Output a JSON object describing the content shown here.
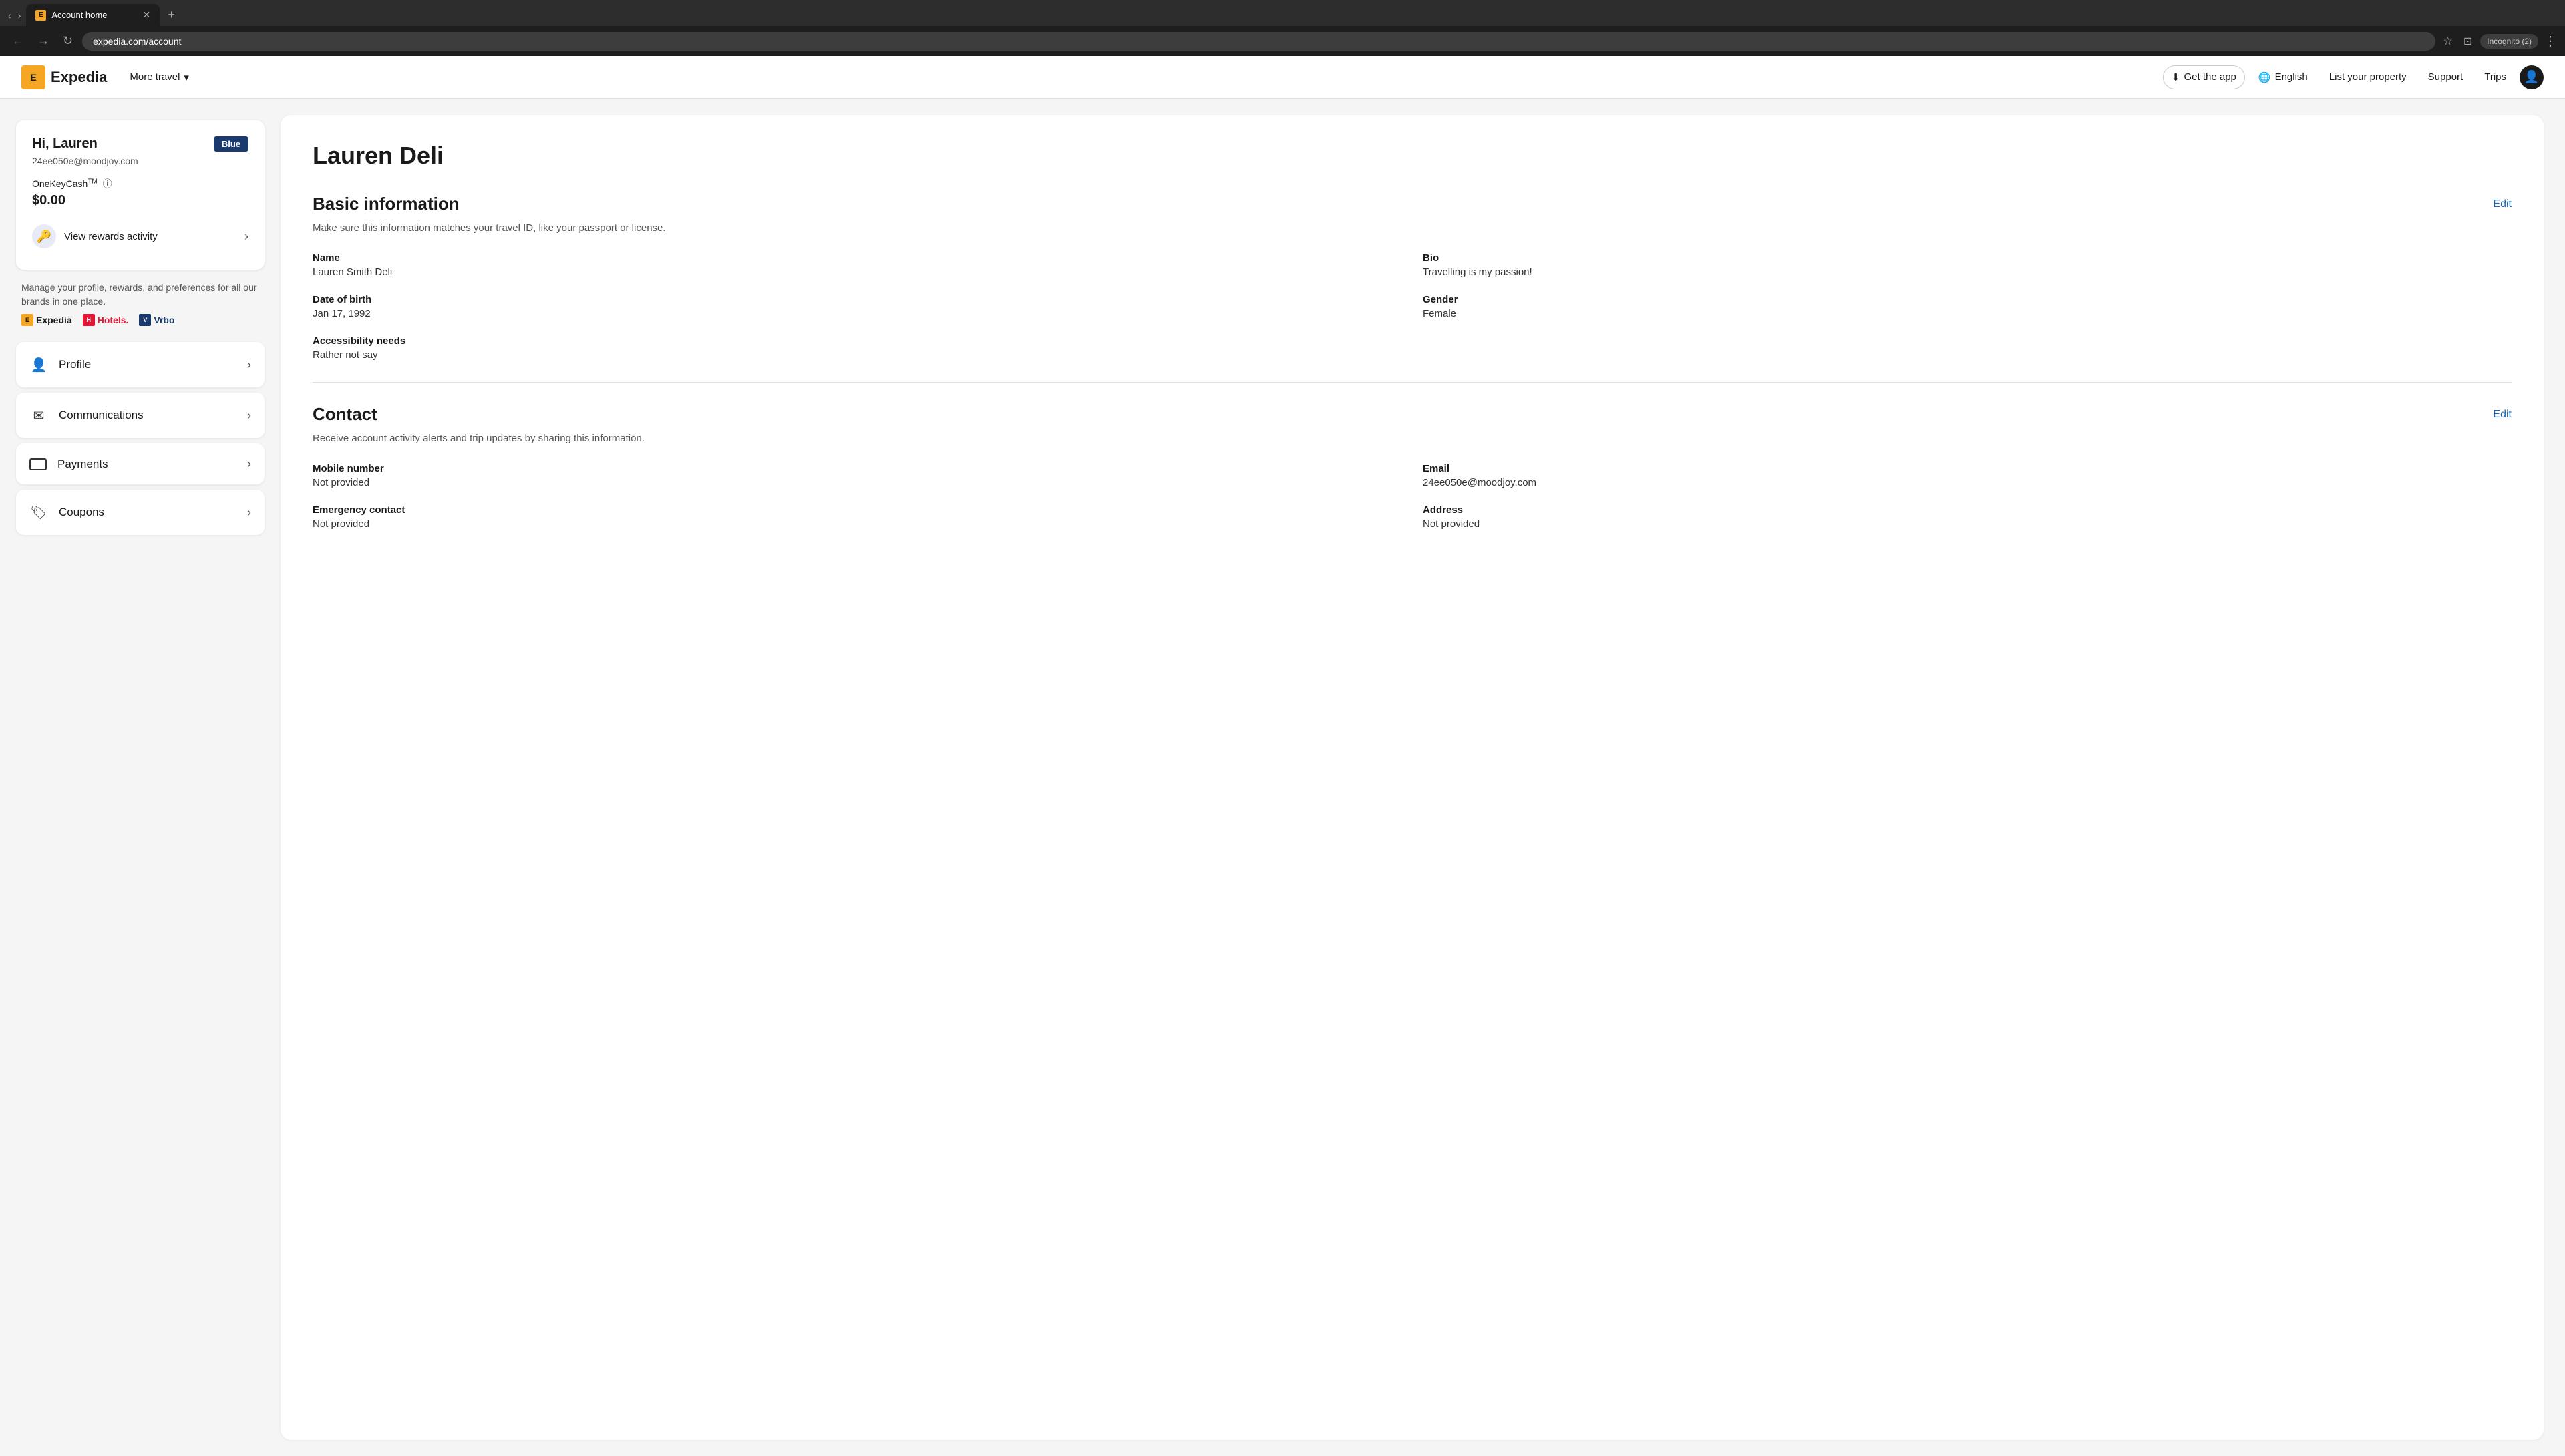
{
  "browser": {
    "tab_title": "Account home",
    "tab_favicon": "E",
    "address": "expedia.com/account",
    "incognito_label": "Incognito (2)",
    "new_tab_label": "+"
  },
  "header": {
    "logo_text": "Expedia",
    "logo_icon": "E",
    "more_travel": "More travel",
    "get_app": "Get the app",
    "language": "English",
    "list_property": "List your property",
    "support": "Support",
    "trips": "Trips"
  },
  "sidebar": {
    "greeting": "Hi, Lauren",
    "email": "24ee050e@moodjoy.com",
    "badge": "Blue",
    "onekey_label": "OneKeyCash",
    "onekey_tm": "TM",
    "onekey_amount": "$0.00",
    "rewards_link": "View rewards activity",
    "manage_text": "Manage your profile, rewards, and preferences for all our brands in one place.",
    "brands": [
      {
        "name": "Expedia",
        "type": "expedia"
      },
      {
        "name": "Hotels.",
        "type": "hotels"
      },
      {
        "name": "Vrbo",
        "type": "vrbo"
      }
    ],
    "nav_items": [
      {
        "id": "profile",
        "label": "Profile",
        "icon": "👤"
      },
      {
        "id": "communications",
        "label": "Communications",
        "icon": "✉"
      },
      {
        "id": "payments",
        "label": "Payments",
        "icon": "▬"
      },
      {
        "id": "coupons",
        "label": "Coupons",
        "icon": "🏷"
      }
    ]
  },
  "profile": {
    "name": "Lauren Deli",
    "basic_info": {
      "title": "Basic information",
      "description": "Make sure this information matches your travel ID, like your passport or license.",
      "edit_label": "Edit",
      "fields": {
        "name_label": "Name",
        "name_value": "Lauren Smith Deli",
        "bio_label": "Bio",
        "bio_value": "Travelling is my passion!",
        "dob_label": "Date of birth",
        "dob_value": "Jan 17, 1992",
        "gender_label": "Gender",
        "gender_value": "Female",
        "accessibility_label": "Accessibility needs",
        "accessibility_value": "Rather not say"
      }
    },
    "contact": {
      "title": "Contact",
      "description": "Receive account activity alerts and trip updates by sharing this information.",
      "edit_label": "Edit",
      "fields": {
        "mobile_label": "Mobile number",
        "mobile_value": "Not provided",
        "email_label": "Email",
        "email_value": "24ee050e@moodjoy.com",
        "emergency_label": "Emergency contact",
        "emergency_value": "Not provided",
        "address_label": "Address",
        "address_value": "Not provided"
      }
    }
  }
}
